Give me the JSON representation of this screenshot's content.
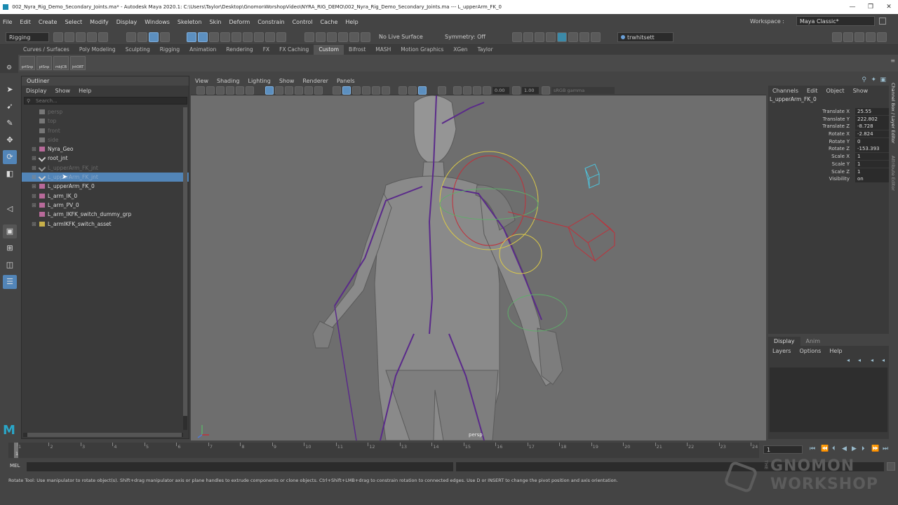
{
  "window": {
    "title": "002_Nyra_Rig_Demo_Secondary_Joints.ma* - Autodesk Maya 2020.1: C:\\Users\\Taylor\\Desktop\\GnomonWorshopVideo\\NYRA_RIG_DEMO\\002_Nyra_Rig_Demo_Secondary_Joints.ma  ---  L_upperArm_FK_0",
    "minimize": "—",
    "maximize": "❐",
    "close": "✕"
  },
  "menubar": {
    "items": [
      "File",
      "Edit",
      "Create",
      "Select",
      "Modify",
      "Display",
      "Windows",
      "Skeleton",
      "Skin",
      "Deform",
      "Constrain",
      "Control",
      "Cache",
      "Help"
    ],
    "workspace_label": "Workspace :",
    "workspace_value": "Maya Classic*"
  },
  "statusline": {
    "menuset": "Rigging",
    "live_surface": "No Live Surface",
    "symmetry": "Symmetry: Off",
    "user": "trwhitsett"
  },
  "shelf": {
    "tabs": [
      "Curves / Surfaces",
      "Poly Modeling",
      "Sculpting",
      "Rigging",
      "Animation",
      "Rendering",
      "FX",
      "FX Caching",
      "Custom",
      "Bifrost",
      "MASH",
      "Motion Graphics",
      "XGen",
      "Taylor"
    ],
    "active_tab": "Custom",
    "buttons": [
      "prtSnp",
      "ptSnp",
      "mkjCB",
      "jntORT"
    ]
  },
  "outliner": {
    "tab": "Outliner",
    "menu": [
      "Display",
      "Show",
      "Help"
    ],
    "search_placeholder": "Search...",
    "rows": [
      {
        "label": "persp",
        "expand": "",
        "dim": true
      },
      {
        "label": "top",
        "expand": "",
        "dim": true
      },
      {
        "label": "front",
        "expand": "",
        "dim": true
      },
      {
        "label": "side",
        "expand": "",
        "dim": true
      },
      {
        "label": "Nyra_Geo",
        "expand": "⊞",
        "dim": false
      },
      {
        "label": "root_jnt",
        "expand": "⊞",
        "dim": false
      },
      {
        "label": "L_upperArm_FK_jnt",
        "expand": "⊞",
        "dim": true
      },
      {
        "label": "L_upperArm_FK_jnt",
        "expand": "⊞",
        "dim": true,
        "selected": true
      },
      {
        "label": "L_upperArm_FK_0",
        "expand": "⊞",
        "dim": false
      },
      {
        "label": "L_arm_IK_0",
        "expand": "⊞",
        "dim": false
      },
      {
        "label": "L_arm_PV_0",
        "expand": "⊞",
        "dim": false
      },
      {
        "label": "L_arm_IKFK_switch_dummy_grp",
        "expand": "",
        "dim": false
      },
      {
        "label": "L_armIKFK_switch_asset",
        "expand": "⊞",
        "dim": false
      }
    ]
  },
  "viewport": {
    "menu": [
      "View",
      "Shading",
      "Lighting",
      "Show",
      "Renderer",
      "Panels"
    ],
    "field_a": "0.00",
    "field_b": "1.00",
    "colorspace": "sRGB gamma",
    "camera_label": "persp"
  },
  "channelbox": {
    "menu": [
      "Channels",
      "Edit",
      "Object",
      "Show"
    ],
    "object": "L_upperArm_FK_0",
    "attrs": [
      {
        "name": "Translate X",
        "value": "25.55"
      },
      {
        "name": "Translate Y",
        "value": "222.802"
      },
      {
        "name": "Translate Z",
        "value": "-8.728"
      },
      {
        "name": "Rotate X",
        "value": "-2.824"
      },
      {
        "name": "Rotate Y",
        "value": "0"
      },
      {
        "name": "Rotate Z",
        "value": "-153.393"
      },
      {
        "name": "Scale X",
        "value": "1"
      },
      {
        "name": "Scale Y",
        "value": "1"
      },
      {
        "name": "Scale Z",
        "value": "1"
      },
      {
        "name": "Visibility",
        "value": "on"
      }
    ],
    "side_tabs": [
      "Channel Box / Layer Editor",
      "Attribute Editor"
    ]
  },
  "layers": {
    "tabs": [
      "Display",
      "Anim"
    ],
    "menu": [
      "Layers",
      "Options",
      "Help"
    ]
  },
  "timeline": {
    "ticks": [
      "1",
      "2",
      "3",
      "4",
      "5",
      "6",
      "7",
      "8",
      "9",
      "10",
      "11",
      "12",
      "13",
      "14",
      "15",
      "16",
      "17",
      "18",
      "19",
      "20",
      "21",
      "22",
      "23",
      "24"
    ],
    "current_frame": "1",
    "current_frame_marker": "1"
  },
  "commandline": {
    "label": "MEL"
  },
  "helpline": {
    "text": "Rotate Tool: Use manipulator to rotate object(s). Shift+drag manipulator axis or plane handles to extrude components or clone objects. Ctrl+Shift+LMB+drag to constrain rotation to connected edges. Use D or INSERT to change the pivot position and axis orientation."
  },
  "watermark": {
    "the": "THE",
    "line1": "GNOMON",
    "line2": "WORKSHOP"
  },
  "colors": {
    "selection": "#5285b8",
    "skeleton": "#5a2a8a",
    "ctrl_yellow": "#d9c84a",
    "ctrl_red": "#c0303a",
    "ctrl_green": "#5fae6a",
    "ctrl_cyan": "#4fc0d8"
  }
}
